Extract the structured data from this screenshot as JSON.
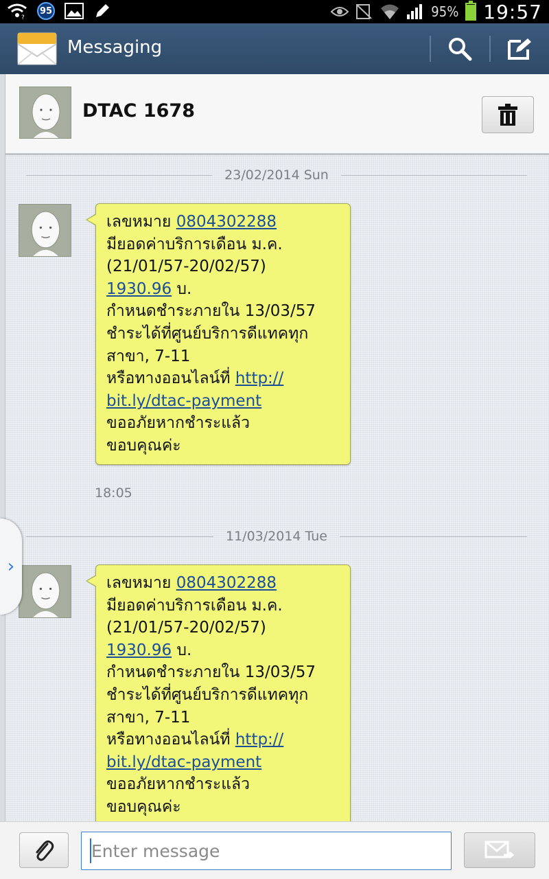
{
  "status_bar": {
    "notification_count": "95",
    "battery_percent": "95%",
    "battery_level": 0.95,
    "clock": "19:57",
    "icons": [
      "wifi-notify-icon",
      "badge-icon",
      "gallery-icon",
      "pen-icon",
      "eye-icon",
      "mute-icon",
      "wifi-icon",
      "signal-icon",
      "battery-icon"
    ]
  },
  "action_bar": {
    "title": "Messaging",
    "icons": [
      "messaging-app-icon",
      "search-icon",
      "compose-icon"
    ]
  },
  "contact": {
    "name": "DTAC 1678",
    "icons": [
      "avatar-icon",
      "trash-icon"
    ]
  },
  "conversation": {
    "messages": [
      {
        "date": "23/02/2014 Sun",
        "time": "18:05",
        "lines": [
          {
            "pre": "เลขหมาย ",
            "link": "0804302288",
            "post": ""
          },
          {
            "pre": "มียอดค่าบริการเดือน ม.ค.",
            "link": "",
            "post": ""
          },
          {
            "pre": "(21/01/57-20/02/57)",
            "link": "",
            "post": ""
          },
          {
            "pre": "",
            "link": "1930.96",
            "post": " บ."
          },
          {
            "pre": "กำหนดชำระภายใน 13/03/57",
            "link": "",
            "post": ""
          },
          {
            "pre": "ชำระได้ที่ศูนย์บริการดีแทคทุก",
            "link": "",
            "post": ""
          },
          {
            "pre": "สาขา, 7-11",
            "link": "",
            "post": ""
          },
          {
            "pre": "หรือทางออนไลน์ที่ ",
            "link": "http://",
            "post": ""
          },
          {
            "pre": "",
            "link": "bit.ly/dtac-payment",
            "post": ""
          },
          {
            "pre": "ขออภัยหากชำระแล้ว",
            "link": "",
            "post": ""
          },
          {
            "pre": "ขอบคุณค่ะ",
            "link": "",
            "post": ""
          }
        ]
      },
      {
        "date": "11/03/2014 Tue",
        "time": "",
        "lines": [
          {
            "pre": "เลขหมาย ",
            "link": "0804302288",
            "post": ""
          },
          {
            "pre": "มียอดค่าบริการเดือน ม.ค.",
            "link": "",
            "post": ""
          },
          {
            "pre": "(21/01/57-20/02/57)",
            "link": "",
            "post": ""
          },
          {
            "pre": "",
            "link": "1930.96",
            "post": " บ."
          },
          {
            "pre": "กำหนดชำระภายใน 13/03/57",
            "link": "",
            "post": ""
          },
          {
            "pre": "ชำระได้ที่ศูนย์บริการดีแทคทุก",
            "link": "",
            "post": ""
          },
          {
            "pre": "สาขา, 7-11",
            "link": "",
            "post": ""
          },
          {
            "pre": "หรือทางออนไลน์ที่ ",
            "link": "http://",
            "post": ""
          },
          {
            "pre": "",
            "link": "bit.ly/dtac-payment",
            "post": ""
          },
          {
            "pre": "ขออภัยหากชำระแล้ว",
            "link": "",
            "post": ""
          },
          {
            "pre": "ขอบคุณค่ะ",
            "link": "",
            "post": ""
          }
        ]
      }
    ]
  },
  "compose": {
    "placeholder": "Enter message",
    "value": "",
    "icons": [
      "paperclip-icon",
      "send-icon"
    ]
  },
  "side_handle": {
    "glyph": "›"
  },
  "colors": {
    "action_bar": "#33506f",
    "bubble": "#f2f77a",
    "link": "#1a4f9c",
    "battery": "#8bd13a",
    "input_border": "#3f7ad3"
  }
}
